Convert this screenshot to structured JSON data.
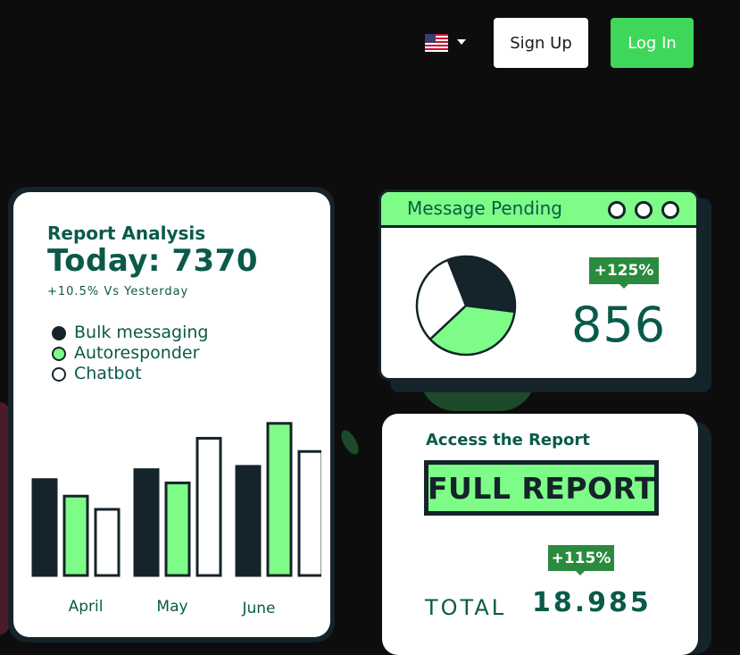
{
  "header": {
    "language_flag": "us-flag-icon",
    "signup_label": "Sign Up",
    "login_label": "Log In"
  },
  "report": {
    "title": "Report Analysis",
    "today": "Today: 7370",
    "subtitle": "+10.5% Vs Yesterday",
    "legend": [
      {
        "label": "Bulk messaging",
        "color": "#15232a"
      },
      {
        "label": "Autoresponder",
        "color": "#7dfc87"
      },
      {
        "label": "Chatbot",
        "color": "#ffffff"
      }
    ],
    "months": [
      "April",
      "May",
      "June"
    ]
  },
  "chart_data": {
    "type": "bar",
    "categories": [
      "April",
      "May",
      "June"
    ],
    "series": [
      {
        "name": "Bulk messaging",
        "values": [
          116,
          128,
          132
        ]
      },
      {
        "name": "Autoresponder",
        "values": [
          96,
          112,
          184
        ]
      },
      {
        "name": "Chatbot",
        "values": [
          80,
          166,
          150
        ]
      }
    ],
    "ylim": [
      0,
      200
    ],
    "colors": [
      "#15232a",
      "#7dfc87",
      "#ffffff"
    ]
  },
  "pending": {
    "title": "Message Pending",
    "badge": "+125%",
    "value": "856",
    "pie": [
      {
        "share": 0.33,
        "color": "#15232a"
      },
      {
        "share": 0.36,
        "color": "#7dfc87"
      },
      {
        "share": 0.31,
        "color": "#ffffff"
      }
    ]
  },
  "access": {
    "title": "Access the Report",
    "button": "FULL REPORT",
    "badge": "+115%",
    "total_label": "TOTAL",
    "total_value": "18.985"
  },
  "colors": {
    "background": "#0d0d0d",
    "accent_green": "#7dfc87",
    "button_green": "#3fd75a",
    "dark": "#15232a",
    "text_teal": "#0a5a4a"
  }
}
